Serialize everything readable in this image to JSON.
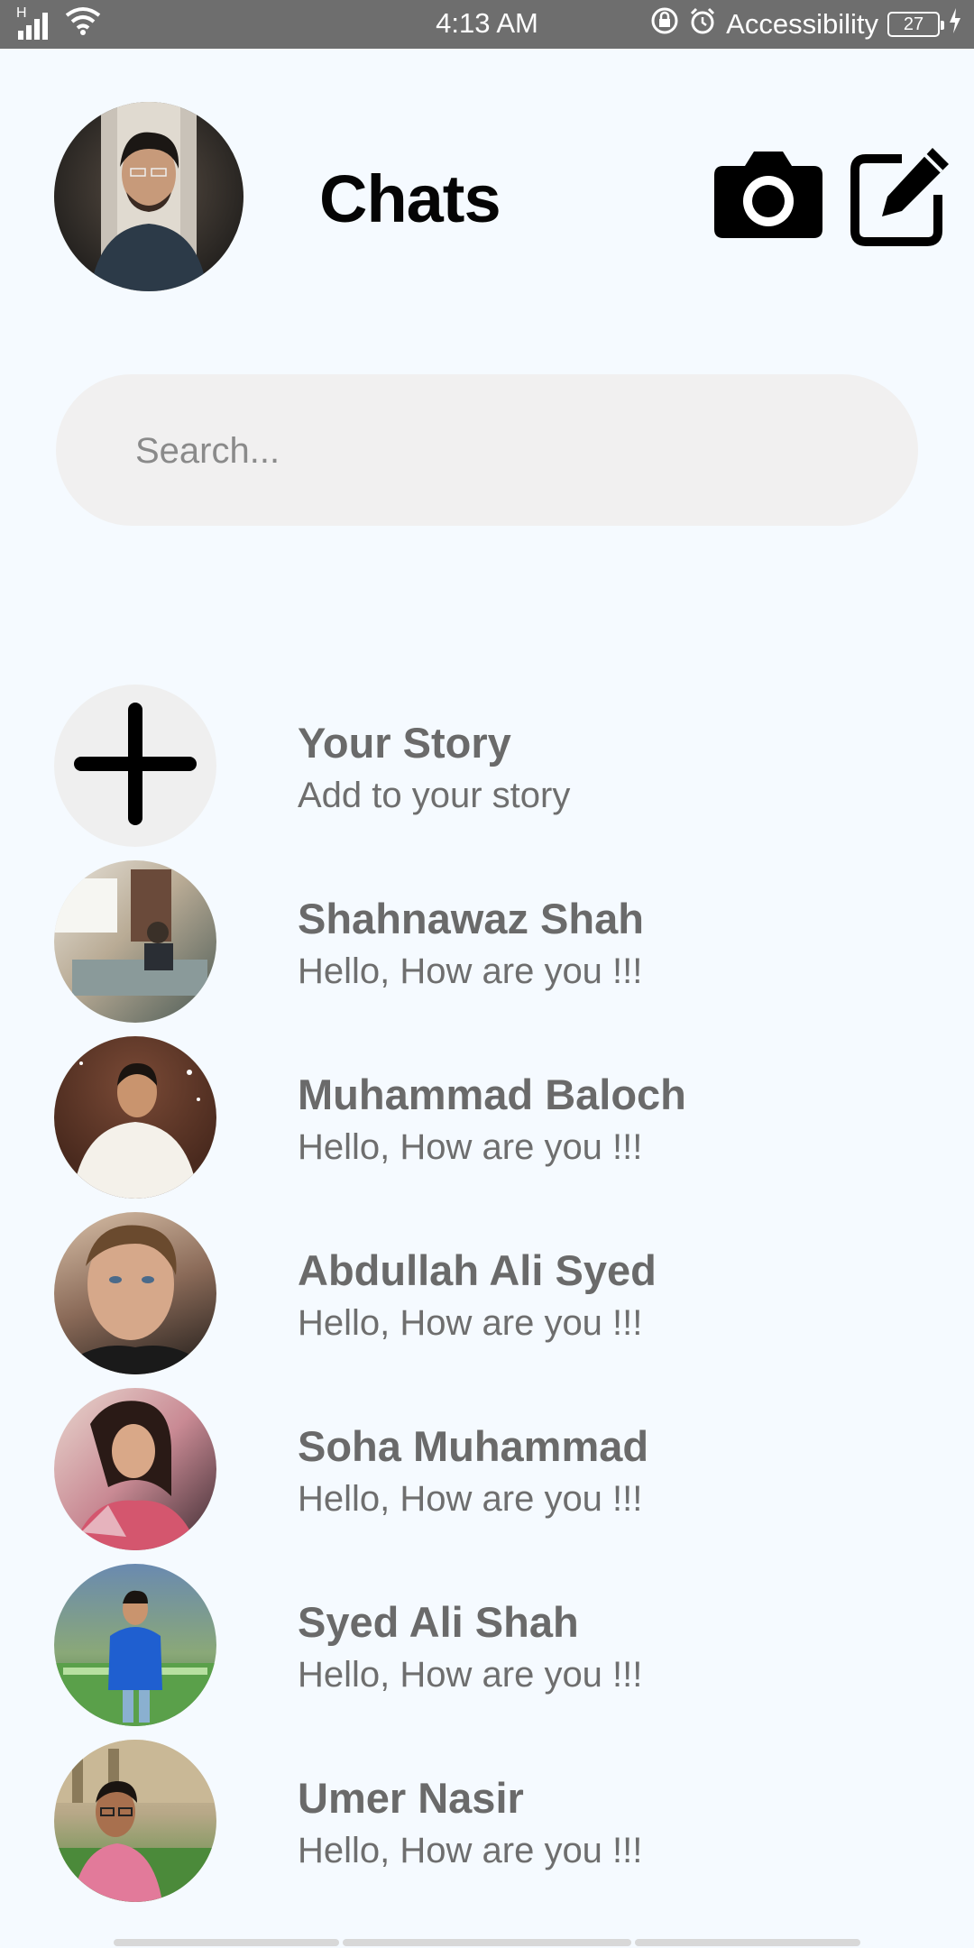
{
  "status_bar": {
    "network_label": "H",
    "time": "4:13 AM",
    "accessibility_label": "Accessibility",
    "battery_level": "27",
    "icons": [
      "signal-icon",
      "wifi-icon",
      "lock-rotation-icon",
      "alarm-icon",
      "battery-icon",
      "charging-icon"
    ]
  },
  "header": {
    "title": "Chats",
    "camera_icon": "camera-icon",
    "compose_icon": "compose-icon"
  },
  "search": {
    "placeholder": "Search...",
    "value": ""
  },
  "story": {
    "name": "Your Story",
    "subtitle": "Add to your story",
    "icon": "plus-icon"
  },
  "chats": [
    {
      "name": "Shahnawaz Shah",
      "message": "Hello, How are you !!!",
      "avatar_colors": [
        "#c9c0b0",
        "#4a5a55"
      ]
    },
    {
      "name": "Muhammad Baloch",
      "message": "Hello, How are you !!!",
      "avatar_colors": [
        "#f2ede4",
        "#6b3b2a"
      ]
    },
    {
      "name": "Abdullah Ali Syed",
      "message": "Hello, How are you !!!",
      "avatar_colors": [
        "#c7a58c",
        "#1d1a18"
      ]
    },
    {
      "name": "Soha Muhammad",
      "message": "Hello, How are you !!!",
      "avatar_colors": [
        "#d9a0a8",
        "#3b2a30"
      ]
    },
    {
      "name": "Syed Ali Shah",
      "message": "Hello, How are you !!!",
      "avatar_colors": [
        "#5a8fd0",
        "#2f6a3a"
      ]
    },
    {
      "name": "Umer Nasir",
      "message": "Hello, How are you !!!",
      "avatar_colors": [
        "#e27a9a",
        "#4b8a3a"
      ]
    }
  ],
  "colors": {
    "background": "#f5faff",
    "status_bar": "#6e6e6e",
    "search_background": "#f1f0f0",
    "title": "#050505",
    "chat_text": "#6a6a6a"
  }
}
